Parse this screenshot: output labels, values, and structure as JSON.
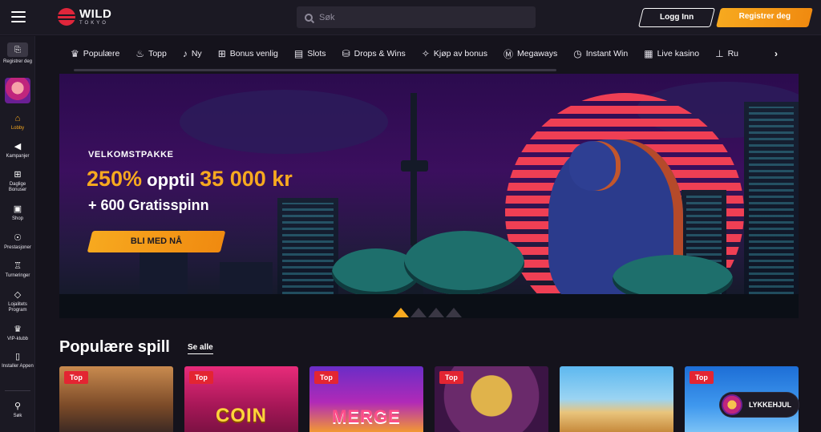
{
  "header": {
    "brand_main": "WILD",
    "brand_sub": "TOKYO",
    "search_placeholder": "Søk",
    "login_label": "Logg Inn",
    "register_label": "Registrer deg"
  },
  "sidebar": {
    "register": "Registrer deg",
    "items": [
      {
        "label": "Lobby",
        "icon": "home-icon"
      },
      {
        "label": "Kampanjer",
        "icon": "megaphone-icon"
      },
      {
        "label": "Daglige Bonuser",
        "icon": "gift-icon"
      },
      {
        "label": "Shop",
        "icon": "shop-icon"
      },
      {
        "label": "Prestasjoner",
        "icon": "medal-icon"
      },
      {
        "label": "Turneringer",
        "icon": "trophy-icon"
      },
      {
        "label": "Lojalitets Program",
        "icon": "diamond-icon"
      },
      {
        "label": "VIP-klubb",
        "icon": "crown-icon"
      },
      {
        "label": "Installer Appen",
        "icon": "phone-icon"
      },
      {
        "label": "Søk",
        "icon": "search-icon"
      }
    ]
  },
  "categories": [
    {
      "label": "Populære",
      "icon": "crown-icon"
    },
    {
      "label": "Topp",
      "icon": "flame-icon"
    },
    {
      "label": "Ny",
      "icon": "bell-icon"
    },
    {
      "label": "Bonus venlig",
      "icon": "gift-icon"
    },
    {
      "label": "Slots",
      "icon": "slot-icon"
    },
    {
      "label": "Drops & Wins",
      "icon": "coins-icon"
    },
    {
      "label": "Kjøp av bonus",
      "icon": "bag-icon"
    },
    {
      "label": "Megaways",
      "icon": "m-icon"
    },
    {
      "label": "Instant Win",
      "icon": "stopwatch-icon"
    },
    {
      "label": "Live kasino",
      "icon": "cards-icon"
    },
    {
      "label": "Ru",
      "icon": "roulette-icon"
    }
  ],
  "banner": {
    "kicker": "VELKOMSTPAKKE",
    "headline_amount": "250%",
    "headline_mid": " opptil ",
    "headline_value": "35 000 kr",
    "sub": "+ 600 Gratisspinn",
    "cta": "BLI MED NÅ"
  },
  "popular": {
    "title": "Populære spill",
    "see_all": "Se alle",
    "games": [
      {
        "tag": "Top",
        "title": ""
      },
      {
        "tag": "Top",
        "title": "COIN"
      },
      {
        "tag": "Top",
        "title": "MERGE"
      },
      {
        "tag": "Top",
        "title": ""
      },
      {
        "tag": "",
        "title": ""
      },
      {
        "tag": "Top",
        "title": ""
      }
    ]
  },
  "wheel": {
    "label": "LYKKEHJUL"
  },
  "colors": {
    "accent": "#f7a91f",
    "badge": "#e32532",
    "background": "#15131c"
  }
}
